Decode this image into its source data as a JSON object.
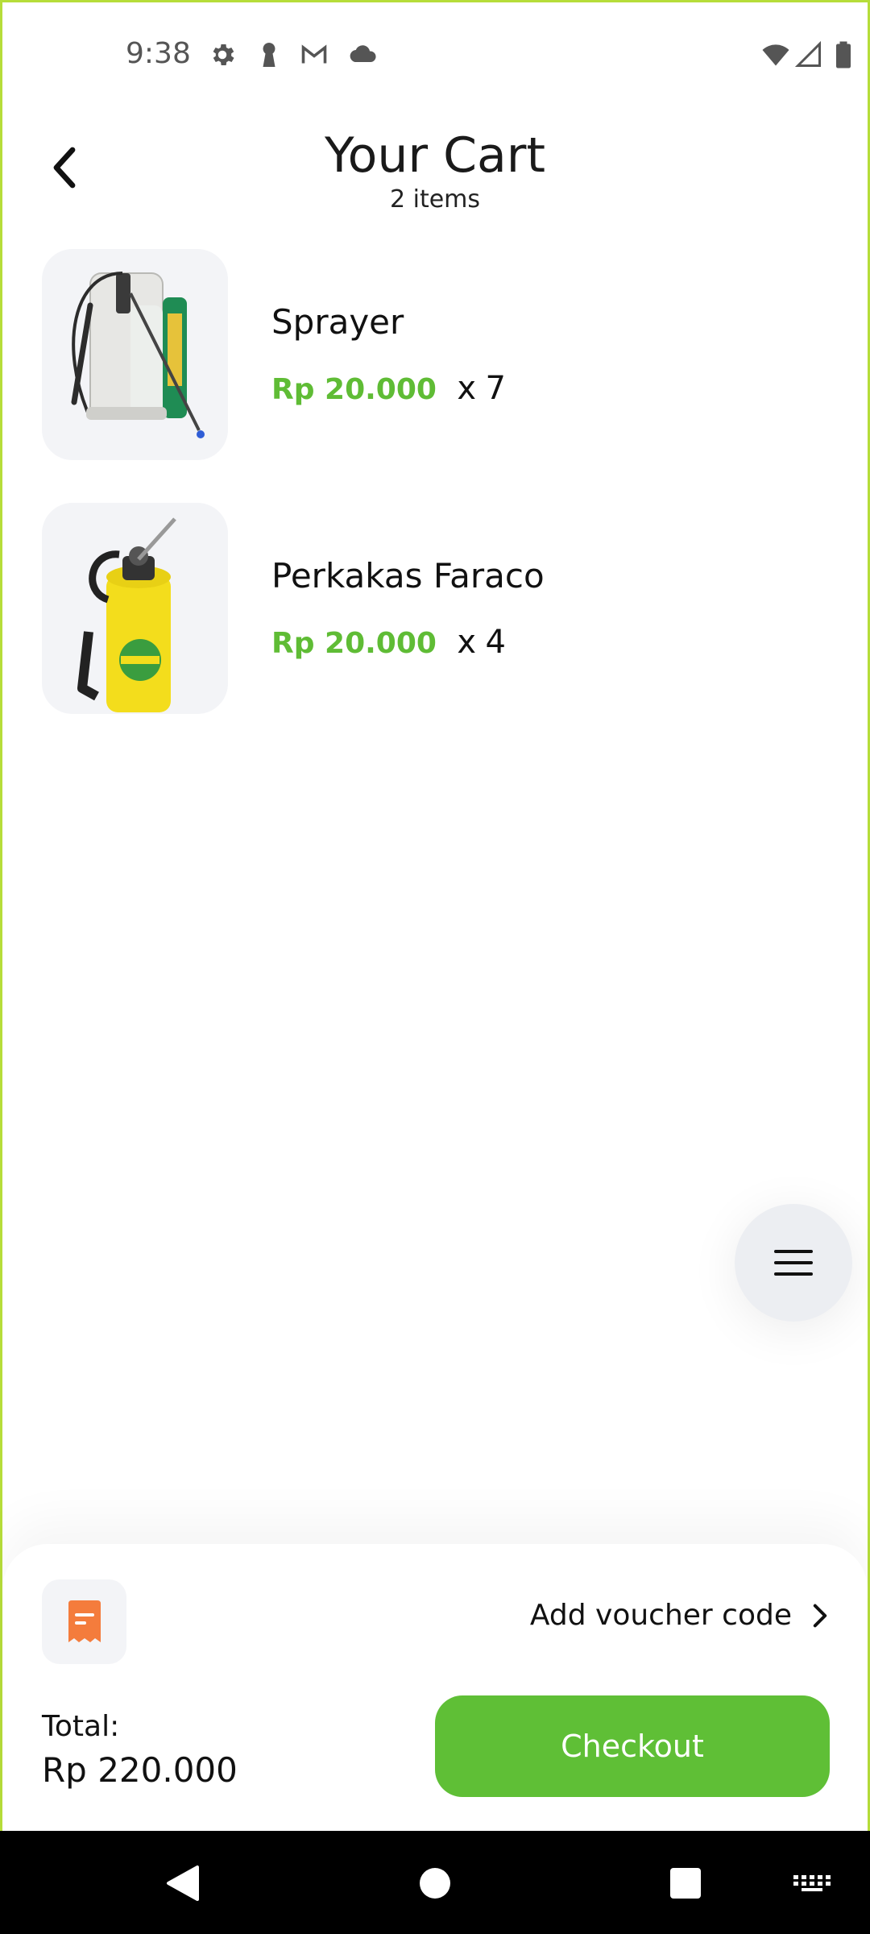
{
  "status_bar": {
    "time": "9:38",
    "icons": [
      "settings-icon",
      "keyhole-icon",
      "gmail-icon",
      "cloud-icon",
      "wifi-icon",
      "signal-icon",
      "battery-icon"
    ]
  },
  "header": {
    "title": "Your Cart",
    "subtitle": "2 items"
  },
  "cart": {
    "items": [
      {
        "name": "Sprayer",
        "price": "Rp 20.000",
        "x": "x",
        "qty": "7"
      },
      {
        "name": "Perkakas Faraco",
        "price": "Rp 20.000",
        "x": "x",
        "qty": "4"
      }
    ]
  },
  "footer": {
    "voucher_label": "Add voucher code",
    "total_label": "Total:",
    "total_value": "Rp 220.000",
    "checkout_label": "Checkout"
  },
  "colors": {
    "accent": "#5fbf36",
    "price": "#5fbc35",
    "voucher_icon": "#f47c3c",
    "frame": "#b6dd3a"
  }
}
